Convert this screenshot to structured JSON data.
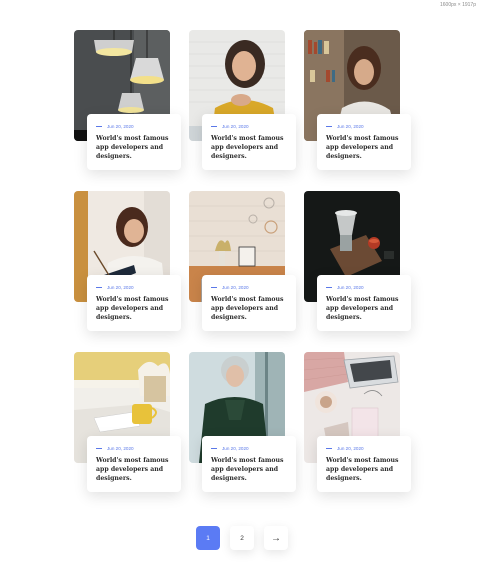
{
  "screen_label": "1600px × 1917p",
  "posts": [
    {
      "date": "Jun 20, 2020",
      "title": "World's most famous app developers and designers.",
      "image": "pendant-lamps-photo"
    },
    {
      "date": "Jun 20, 2020",
      "title": "World's most famous app developers and designers.",
      "image": "smiling-woman-photo"
    },
    {
      "date": "Jun 20, 2020",
      "title": "World's most famous app developers and designers.",
      "image": "woman-studying-photo"
    },
    {
      "date": "Jun 20, 2020",
      "title": "World's most famous app developers and designers.",
      "image": "woman-writing-photo"
    },
    {
      "date": "Jun 20, 2020",
      "title": "World's most famous app developers and designers.",
      "image": "interior-shelf-photo"
    },
    {
      "date": "Jun 20, 2020",
      "title": "World's most famous app developers and designers.",
      "image": "coffee-brewer-photo"
    },
    {
      "date": "Jun 20, 2020",
      "title": "World's most famous app developers and designers.",
      "image": "coffee-mug-desk-photo"
    },
    {
      "date": "Jun 20, 2020",
      "title": "World's most famous app developers and designers.",
      "image": "woman-green-jacket-photo"
    },
    {
      "date": "Jun 20, 2020",
      "title": "World's most famous app developers and designers.",
      "image": "laptop-flatlay-photo"
    }
  ],
  "pagination": {
    "pages": [
      "1",
      "2"
    ],
    "active": "1",
    "next_icon": "arrow-right-icon",
    "next_label": "→"
  },
  "colors": {
    "accent": "#5b7bf4",
    "date": "#5a78e8",
    "title": "#2b2b2b"
  }
}
